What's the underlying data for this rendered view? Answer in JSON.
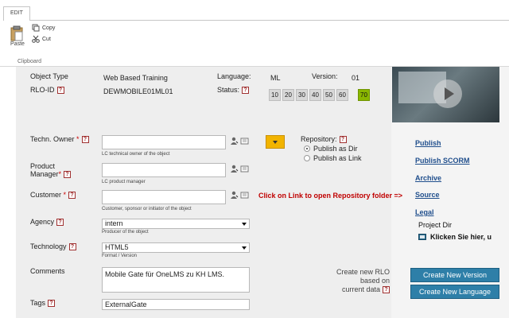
{
  "ribbon": {
    "tab": "EDIT",
    "paste": "Paste",
    "copy": "Copy",
    "cut": "Cut",
    "group": "Clipboard"
  },
  "header": {
    "object_type_label": "Object Type",
    "object_type_value": "Web Based Training",
    "language_label": "Language:",
    "language_value": "ML",
    "version_label": "Version:",
    "version_value": "01",
    "rlo_id_label": "RLO-ID",
    "rlo_id_value": "DEWMOBILE01ML01",
    "status_label": "Status:",
    "status_values": [
      "10",
      "20",
      "30",
      "40",
      "50",
      "60",
      "70"
    ],
    "status_active": "70"
  },
  "help_glyph": "?",
  "required_mark": "*",
  "form": {
    "tech_owner_label": "Techn. Owner",
    "tech_owner_value": "",
    "tech_owner_hint": "LC technical owner of the object",
    "product_manager_label1": "Product",
    "product_manager_label2": "Manager",
    "product_manager_value": "",
    "product_manager_hint": "LC product manager",
    "customer_label": "Customer",
    "customer_value": "",
    "customer_hint": "Customer, sponsor or initiator of the object",
    "agency_label": "Agency",
    "agency_value": "intern",
    "agency_hint": "Producer of the object",
    "technology_label": "Technology",
    "technology_value": "HTML5",
    "technology_hint": "Format / Version",
    "comments_label": "Comments",
    "comments_value": "Mobile Gate für OneLMS zu KH LMS.",
    "tags_label": "Tags",
    "tags_value": "ExternalGate"
  },
  "repository": {
    "label": "Repository:",
    "option1": "Publish as Dir",
    "option2": "Publish as Link",
    "selected": "Publish as Dir",
    "note": "Click on Link to open Repository folder  =>"
  },
  "sidebar": {
    "publish": "Publish",
    "publish_scorm": "Publish SCORM",
    "archive": "Archive",
    "source": "Source",
    "legal": "Legal",
    "project_dir": "Project Dir",
    "klicken": "Klicken Sie hier, u"
  },
  "create": {
    "label1": "Create new RLO",
    "label2": "based on",
    "label3": "current data",
    "new_version": "Create New Version",
    "new_language": "Create New Language"
  },
  "colors": {
    "status_active": "#8ab800",
    "button_blue": "#2e7fa8",
    "link_blue": "#1f4e8c",
    "note_red": "#c00000",
    "orange": "#f2b400"
  }
}
